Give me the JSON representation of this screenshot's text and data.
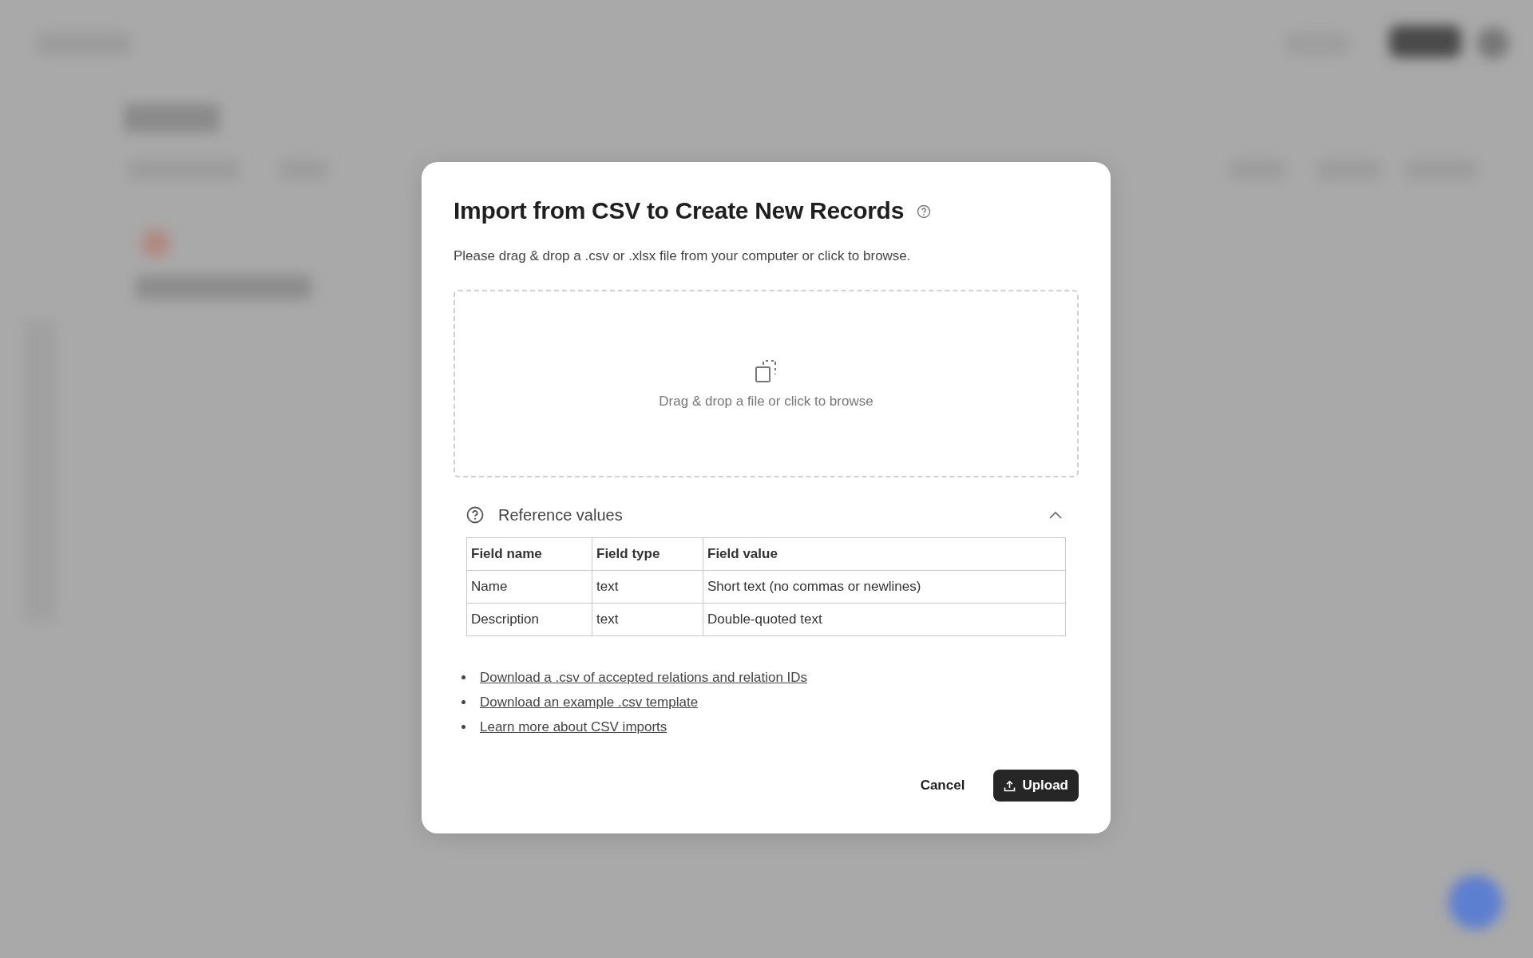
{
  "dialog": {
    "title": "Import from CSV to Create New Records",
    "subtitle": "Please drag & drop a .csv or .xlsx file from your computer or click to browse.",
    "dropzone": {
      "text": "Drag & drop a file or click to browse"
    },
    "reference": {
      "title": "Reference values",
      "expanded": true,
      "columns": [
        "Field name",
        "Field type",
        "Field value"
      ],
      "rows": [
        [
          "Name",
          "text",
          "Short text (no commas or newlines)"
        ],
        [
          "Description",
          "text",
          "Double-quoted text"
        ]
      ]
    },
    "links": [
      "Download a .csv of accepted relations and relation IDs",
      "Download an example .csv template",
      "Learn more about CSV imports"
    ],
    "buttons": [
      {
        "label": "Cancel",
        "kind": "secondary"
      },
      {
        "label": "Upload",
        "kind": "primary"
      }
    ]
  }
}
